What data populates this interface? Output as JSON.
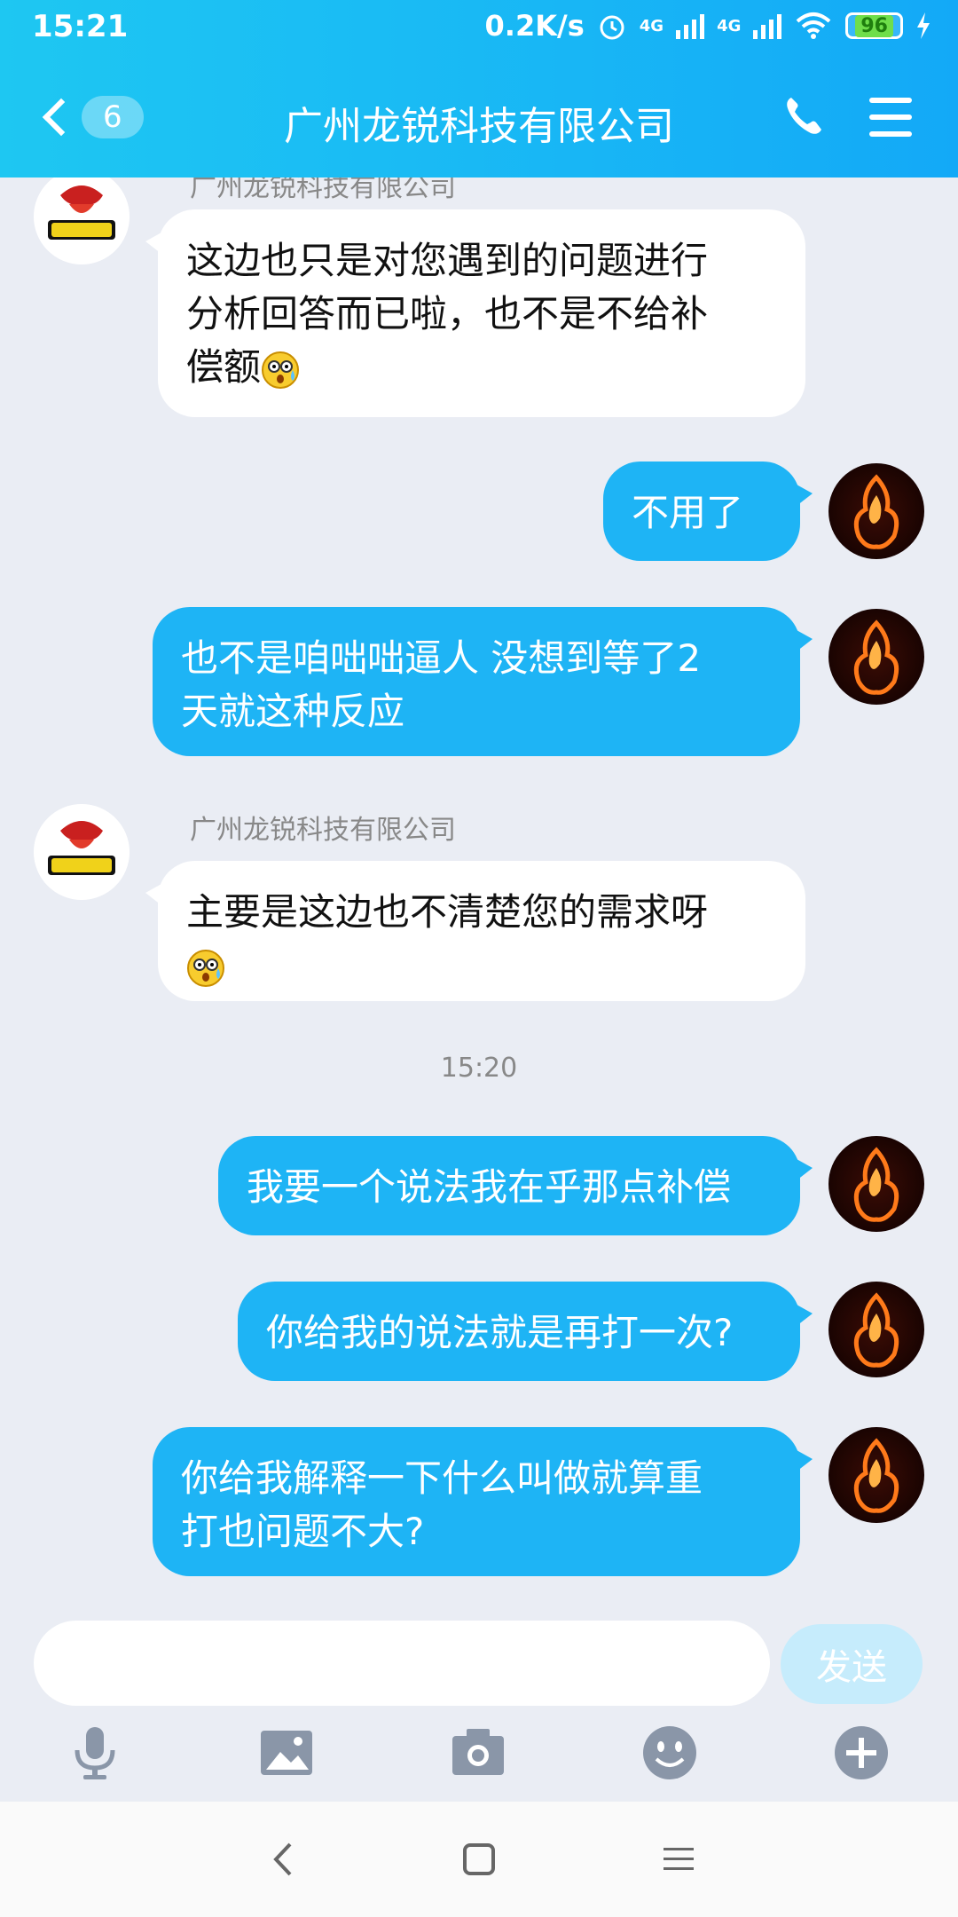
{
  "status": {
    "time": "15:21",
    "net_speed": "0.2K/s",
    "net1": "4G",
    "net2": "4G",
    "battery": "96"
  },
  "nav": {
    "unread_count": "6",
    "title": "广州龙锐科技有限公司"
  },
  "messages": [
    {
      "side": "in",
      "sender": "广州龙锐科技有限公司",
      "line1": "这边也只是对您遇到的问题进行",
      "line2": "分析回答而已啦，也不是不给补",
      "line3": "偿额"
    },
    {
      "side": "out",
      "text": "不用了"
    },
    {
      "side": "out",
      "line1": "也不是咱咄咄逼人  没想到等了2",
      "line2": "天就这种反应"
    },
    {
      "side": "in",
      "sender": "广州龙锐科技有限公司",
      "line1": "主要是这边也不清楚您的需求呀"
    },
    {
      "side": "out",
      "text": "我要一个说法我在乎那点补偿"
    },
    {
      "side": "out",
      "text": "你给我的说法就是再打一次?"
    },
    {
      "side": "out",
      "line1": "你给我解释一下什么叫做就算重",
      "line2": "打也问题不大?"
    }
  ],
  "timestamp": "15:20",
  "composer": {
    "placeholder": "",
    "send_label": "发送"
  },
  "toolbar_icons": [
    "microphone-icon",
    "image-icon",
    "camera-icon",
    "emoji-icon",
    "plus-icon"
  ],
  "system_nav": [
    "back-icon",
    "home-icon",
    "recents-icon"
  ]
}
